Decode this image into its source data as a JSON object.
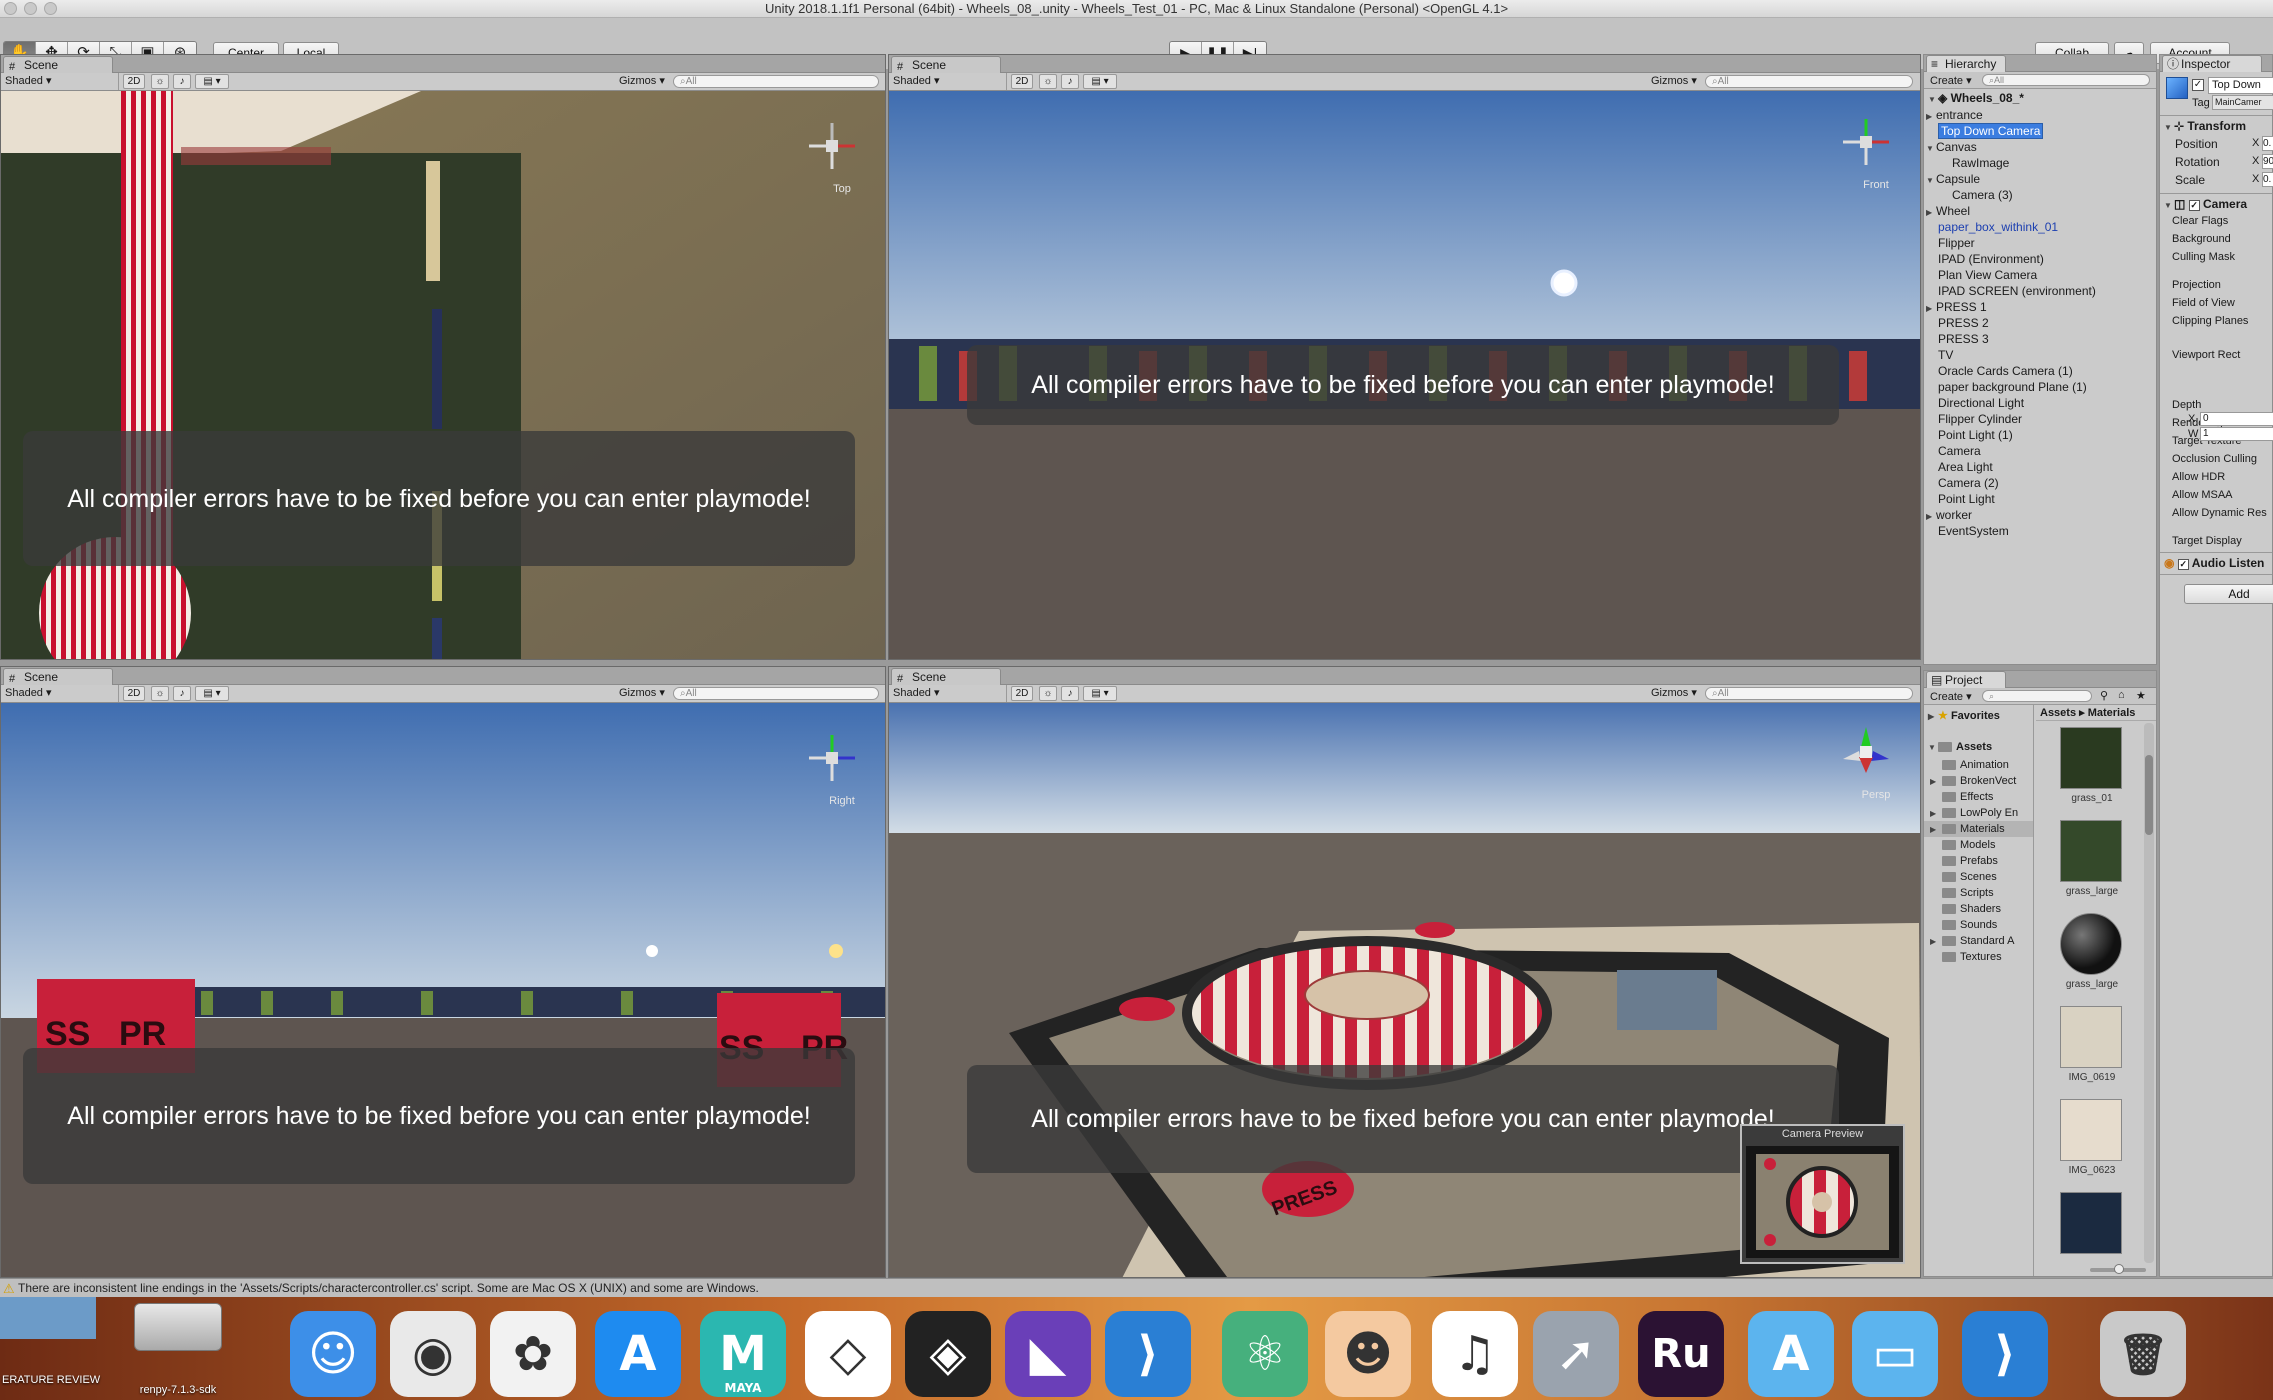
{
  "window": {
    "title": "Unity 2018.1.1f1 Personal (64bit) - Wheels_08_.unity - Wheels_Test_01 - PC, Mac & Linux Standalone (Personal) <OpenGL 4.1>"
  },
  "toolbar": {
    "tools": [
      "hand-icon",
      "move-icon",
      "rotate-icon",
      "scale-icon",
      "rect-icon",
      "transform-icon"
    ],
    "pivot": "Center",
    "space": "Local",
    "collab": "Collab",
    "account": "Account"
  },
  "scene_views": [
    {
      "tab": "Scene",
      "shading": "Shaded",
      "mode2d": "2D",
      "gizmos": "Gizmos",
      "search": "All",
      "axis_label": "Top",
      "error": "All compiler errors have to be fixed before you can enter playmode!"
    },
    {
      "tab": "Scene",
      "shading": "Shaded",
      "mode2d": "2D",
      "gizmos": "Gizmos",
      "search": "All",
      "axis_label": "Front",
      "error": "All compiler errors have to be fixed before you can enter playmode!"
    },
    {
      "tab": "Scene",
      "shading": "Shaded",
      "mode2d": "2D",
      "gizmos": "Gizmos",
      "search": "All",
      "axis_label": "Right",
      "error": "All compiler errors have to be fixed before you can enter playmode!"
    },
    {
      "tab": "Scene",
      "shading": "Shaded",
      "mode2d": "2D",
      "gizmos": "Gizmos",
      "search": "All",
      "axis_label": "Persp",
      "error": "All compiler errors have to be fixed before you can enter playmode!"
    }
  ],
  "camera_preview": {
    "title": "Camera Preview"
  },
  "scene_labels": {
    "press": "PRESS",
    "ss": "SS",
    "pr": "PR"
  },
  "hierarchy": {
    "tab": "Hierarchy",
    "create": "Create",
    "search": "All",
    "scene": "Wheels_08_*",
    "items": [
      {
        "label": "entrance",
        "arrow": true
      },
      {
        "label": "Top Down Camera",
        "selected": true
      },
      {
        "label": "Canvas",
        "arrow": true,
        "open": true
      },
      {
        "label": "RawImage",
        "indent": 2
      },
      {
        "label": "Capsule",
        "arrow": true,
        "open": true
      },
      {
        "label": "Camera (3)",
        "indent": 2
      },
      {
        "label": "Wheel",
        "arrow": true
      },
      {
        "label": "paper_box_withink_01",
        "prefab": true
      },
      {
        "label": "Flipper"
      },
      {
        "label": "IPAD (Environment)"
      },
      {
        "label": "Plan View Camera"
      },
      {
        "label": "IPAD SCREEN (environment)"
      },
      {
        "label": "PRESS 1",
        "arrow": true
      },
      {
        "label": "PRESS 2"
      },
      {
        "label": "PRESS 3"
      },
      {
        "label": "TV"
      },
      {
        "label": "Oracle Cards Camera (1)"
      },
      {
        "label": "paper background Plane (1)"
      },
      {
        "label": "Directional Light"
      },
      {
        "label": "Flipper Cylinder"
      },
      {
        "label": "Point Light (1)"
      },
      {
        "label": "Camera"
      },
      {
        "label": "Area Light"
      },
      {
        "label": "Camera (2)"
      },
      {
        "label": "Point Light"
      },
      {
        "label": "worker",
        "arrow": true
      },
      {
        "label": "EventSystem"
      }
    ]
  },
  "project": {
    "tab": "Project",
    "create": "Create",
    "favorites": "Favorites",
    "breadcrumb": [
      "Assets",
      "Materials"
    ],
    "root": "Assets",
    "folders": [
      {
        "label": "Animation"
      },
      {
        "label": "BrokenVect",
        "arrow": true
      },
      {
        "label": "Effects"
      },
      {
        "label": "LowPoly En",
        "arrow": true
      },
      {
        "label": "Materials",
        "selected": true,
        "arrow": true
      },
      {
        "label": "Models"
      },
      {
        "label": "Prefabs"
      },
      {
        "label": "Scenes"
      },
      {
        "label": "Scripts"
      },
      {
        "label": "Shaders"
      },
      {
        "label": "Sounds"
      },
      {
        "label": "Standard A",
        "arrow": true
      },
      {
        "label": "Textures"
      }
    ],
    "assets": [
      {
        "label": "grass_01",
        "color": "#2a3a20"
      },
      {
        "label": "grass_large",
        "color": "#34492a"
      },
      {
        "label": "grass_large",
        "color": "#111111"
      },
      {
        "label": "IMG_0619",
        "color": "#d9d2c2"
      },
      {
        "label": "IMG_0623",
        "color": "#e6dccd"
      },
      {
        "label": "",
        "color": "#1b2a40"
      }
    ]
  },
  "inspector": {
    "tab": "Inspector",
    "object_name": "Top Down",
    "tag_label": "Tag",
    "tag_value": "MainCamer",
    "transform": {
      "header": "Transform",
      "rows": [
        {
          "label": "Position",
          "axis": "X",
          "value": "0."
        },
        {
          "label": "Rotation",
          "axis": "X",
          "value": "90"
        },
        {
          "label": "Scale",
          "axis": "X",
          "value": "0."
        }
      ]
    },
    "camera": {
      "header": "Camera",
      "props": [
        "Clear Flags",
        "Background",
        "Culling Mask",
        "Projection",
        "Field of View",
        "Clipping Planes",
        "Viewport Rect",
        "Depth",
        "Rendering Path",
        "Target Texture",
        "Occlusion Culling",
        "Allow HDR",
        "Allow MSAA",
        "Allow Dynamic Res",
        "Target Display"
      ],
      "viewport": [
        {
          "axis": "X",
          "value": "0"
        },
        {
          "axis": "W",
          "value": "1"
        }
      ]
    },
    "audio": "Audio Listen",
    "add_button": "Add"
  },
  "status": {
    "message": "There are inconsistent line endings in the 'Assets/Scripts/charactercontroller.cs' script. Some are Mac OS X (UNIX) and some are Windows."
  },
  "dock": {
    "left_items": [
      {
        "label": "ERATURE REVIEW"
      },
      {
        "label": "renpy-7.1.3-sdk"
      }
    ],
    "apps": [
      {
        "name": "finder-icon",
        "glyph": "☺",
        "bg": "#3d8fe8"
      },
      {
        "name": "chrome-icon",
        "glyph": "◉",
        "bg": "#e9e9e9"
      },
      {
        "name": "photos-icon",
        "glyph": "✿",
        "bg": "#f2f2f2"
      },
      {
        "name": "app-store-icon",
        "glyph": "A",
        "bg": "#1e8bf0"
      },
      {
        "name": "maya-icon",
        "glyph": "M",
        "bg": "#2bb7b0",
        "label": "MAYA"
      },
      {
        "name": "unity-hub-icon",
        "glyph": "◇",
        "bg": "#ffffff"
      },
      {
        "name": "unity-icon",
        "glyph": "◈",
        "bg": "#222222"
      },
      {
        "name": "visual-studio-icon",
        "glyph": "◣",
        "bg": "#6a3fb8"
      },
      {
        "name": "vscode-icon",
        "glyph": "⟩",
        "bg": "#2a7fd4"
      },
      {
        "name": "atom-icon",
        "glyph": "⚛",
        "bg": "#46b07d"
      },
      {
        "name": "renpy-icon",
        "glyph": "☻",
        "bg": "#f4c9a0"
      },
      {
        "name": "itunes-icon",
        "glyph": "♫",
        "bg": "#ffffff"
      },
      {
        "name": "launchpad-icon",
        "glyph": "➚",
        "bg": "#9aa3ae"
      },
      {
        "name": "rush-icon",
        "glyph": "Ru",
        "bg": "#2b1233"
      },
      {
        "name": "applications-folder-icon",
        "glyph": "A",
        "bg": "#5cb4ee"
      },
      {
        "name": "documents-folder-icon",
        "glyph": "▭",
        "bg": "#5cb4ee"
      },
      {
        "name": "vscode-recent-icon",
        "glyph": "⟩",
        "bg": "#2a7fd4"
      },
      {
        "name": "trash-icon",
        "glyph": "🗑",
        "bg": "#c9c9c9"
      }
    ]
  }
}
